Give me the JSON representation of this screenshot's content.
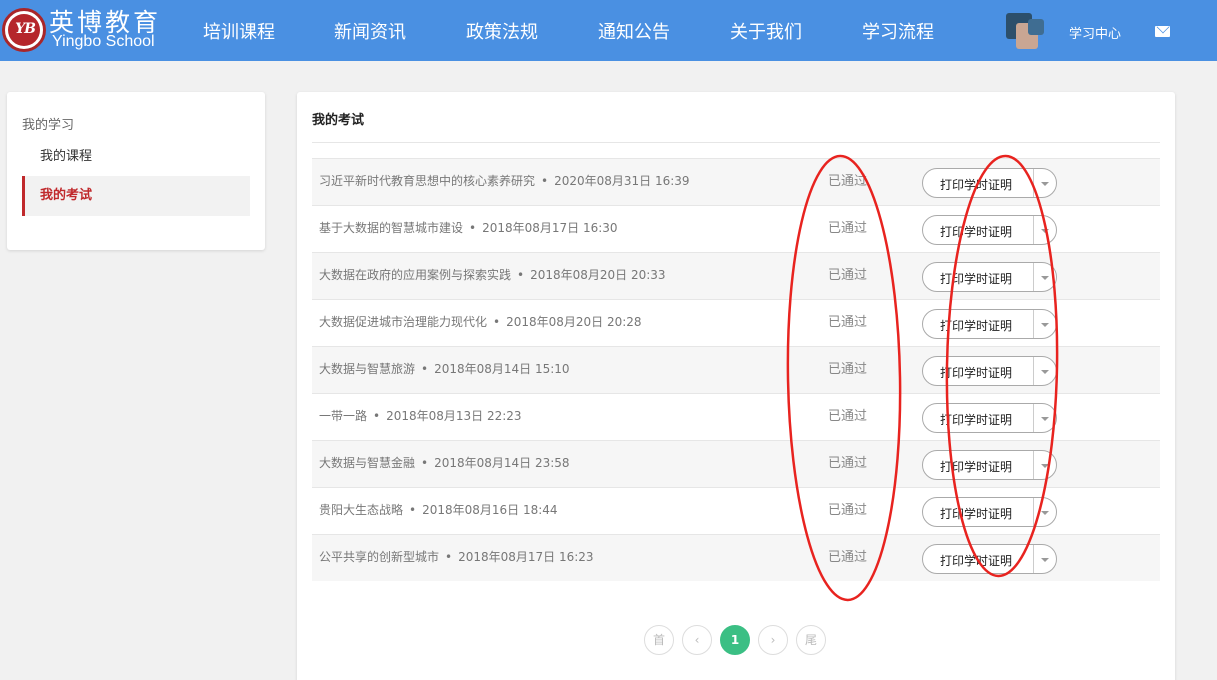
{
  "header": {
    "logo_cn": "英博教育",
    "logo_en": "Yingbo School",
    "logo_seal": "YB",
    "nav": [
      "培训课程",
      "新闻资讯",
      "政策法规",
      "通知公告",
      "关于我们",
      "学习流程"
    ],
    "study_center": "学习中心",
    "brand_color": "#4a90e2",
    "icons": {
      "mail": "mail-icon",
      "avatar": "avatar"
    }
  },
  "sidebar": {
    "title": "我的学习",
    "items": [
      {
        "label": "我的课程",
        "active": false
      },
      {
        "label": "我的考试",
        "active": true
      }
    ],
    "accent_color": "#c0292c"
  },
  "main": {
    "title": "我的考试",
    "separator": "•",
    "rows": [
      {
        "name": "习近平新时代教育思想中的核心素养研究",
        "time": "2020年08月31日 16:39",
        "status": "已通过",
        "action": "打印学时证明"
      },
      {
        "name": "基于大数据的智慧城市建设",
        "time": "2018年08月17日 16:30",
        "status": "已通过",
        "action": "打印学时证明"
      },
      {
        "name": "大数据在政府的应用案例与探索实践",
        "time": "2018年08月20日 20:33",
        "status": "已通过",
        "action": "打印学时证明"
      },
      {
        "name": "大数据促进城市治理能力现代化",
        "time": "2018年08月20日 20:28",
        "status": "已通过",
        "action": "打印学时证明"
      },
      {
        "name": "大数据与智慧旅游",
        "time": "2018年08月14日 15:10",
        "status": "已通过",
        "action": "打印学时证明"
      },
      {
        "name": "一带一路",
        "time": "2018年08月13日 22:23",
        "status": "已通过",
        "action": "打印学时证明"
      },
      {
        "name": "大数据与智慧金融",
        "time": "2018年08月14日 23:58",
        "status": "已通过",
        "action": "打印学时证明"
      },
      {
        "name": "贵阳大生态战略",
        "time": "2018年08月16日 18:44",
        "status": "已通过",
        "action": "打印学时证明"
      },
      {
        "name": "公平共享的创新型城市",
        "time": "2018年08月17日 16:23",
        "status": "已通过",
        "action": "打印学时证明"
      }
    ]
  },
  "pagination": {
    "first": "首",
    "prev": "‹",
    "current": "1",
    "next": "›",
    "last": "尾",
    "active_color": "#3bbf84"
  },
  "annotation_color": "#e8231f"
}
